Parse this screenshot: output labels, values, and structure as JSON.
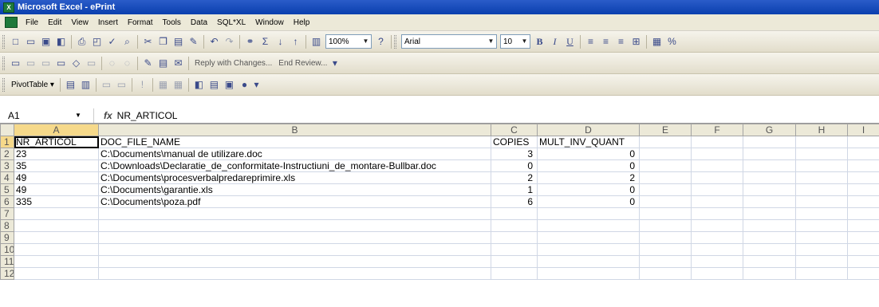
{
  "window": {
    "title": "Microsoft Excel - ePrint",
    "app_icon": "excel-icon"
  },
  "menu": [
    "File",
    "Edit",
    "View",
    "Insert",
    "Format",
    "Tools",
    "Data",
    "SQL*XL",
    "Window",
    "Help"
  ],
  "standard_toolbar": {
    "zoom": "100%",
    "font_name": "Arial",
    "font_size": "10",
    "bold": "B",
    "italic": "I",
    "underline": "U",
    "percent": "%"
  },
  "reviewing_toolbar": {
    "reply_label": "Reply with Changes...",
    "end_review_label": "End Review..."
  },
  "pivot_toolbar": {
    "pivot_label": "PivotTable"
  },
  "formula_bar": {
    "name_box": "A1",
    "fx": "fx",
    "content": "NR_ARTICOL"
  },
  "colors": {
    "title_bar": "#0a3fae",
    "toolbar": "#ece9d8",
    "selected_header": "#f6d98a",
    "grid_line": "#d0d7e5"
  },
  "sheet": {
    "columns": [
      "A",
      "B",
      "C",
      "D",
      "E",
      "F",
      "G",
      "H",
      "I"
    ],
    "row_numbers": [
      "1",
      "2",
      "3",
      "4",
      "5",
      "6",
      "7",
      "8",
      "9",
      "10",
      "11",
      "12"
    ],
    "rows": [
      [
        "NR_ARTICOL",
        "DOC_FILE_NAME",
        "COPIES",
        "MULT_INV_QUANT"
      ],
      [
        "23",
        "C:\\Documents\\manual de utilizare.doc",
        "3",
        "0"
      ],
      [
        "35",
        "C:\\Downloads\\Declaratie_de_conformitate-Instructiuni_de_montare-Bullbar.doc",
        "0",
        "0"
      ],
      [
        "49",
        "C:\\Documents\\procesverbalpredareprimire.xls",
        "2",
        "2"
      ],
      [
        "49",
        "C:\\Documents\\garantie.xls",
        "1",
        "0"
      ],
      [
        "335",
        "C:\\Documents\\poza.pdf",
        "6",
        "0"
      ]
    ]
  }
}
